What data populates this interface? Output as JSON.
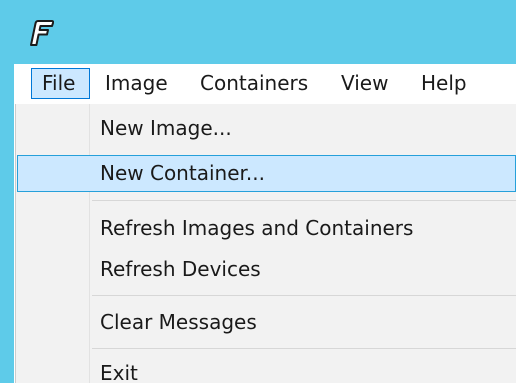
{
  "colors": {
    "titlebar": "#5ecbe9",
    "menu_highlight": "#cce8ff",
    "menu_highlight_border": "#26a0da",
    "dropdown_bg": "#f2f2f2"
  },
  "titlebar": {
    "icon": "app-logo-icon"
  },
  "menubar": {
    "items": [
      {
        "label": "File"
      },
      {
        "label": "Image"
      },
      {
        "label": "Containers"
      },
      {
        "label": "View"
      },
      {
        "label": "Help"
      }
    ]
  },
  "file_menu": {
    "items": [
      {
        "label": "New Image..."
      },
      {
        "label": "New Container..."
      },
      {
        "label": "Refresh Images and Containers"
      },
      {
        "label": "Refresh Devices"
      },
      {
        "label": "Clear Messages"
      },
      {
        "label": "Exit"
      }
    ]
  }
}
